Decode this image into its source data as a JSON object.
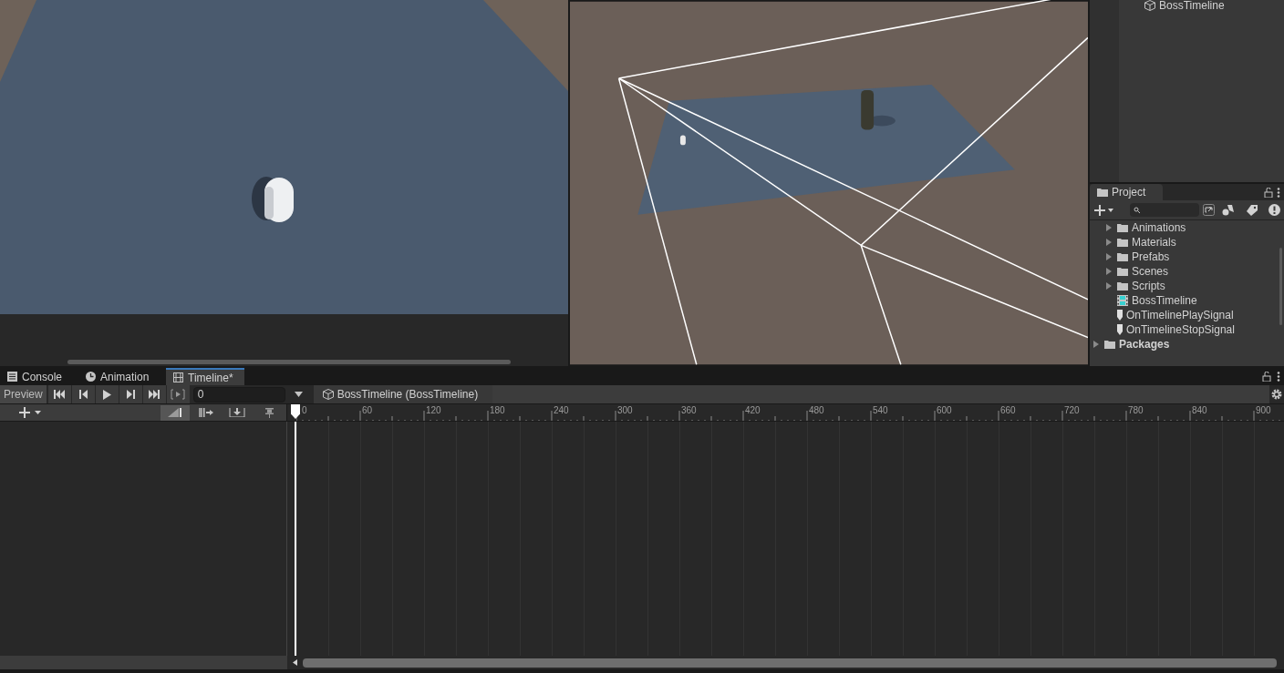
{
  "hierarchy": {
    "items": [
      {
        "label": "BossTimeline"
      }
    ]
  },
  "project": {
    "tab": "Project",
    "asset_items": [
      {
        "label": "Animations",
        "kind": "folder"
      },
      {
        "label": "Materials",
        "kind": "folder"
      },
      {
        "label": "Prefabs",
        "kind": "folder"
      },
      {
        "label": "Scenes",
        "kind": "folder"
      },
      {
        "label": "Scripts",
        "kind": "folder"
      },
      {
        "label": "BossTimeline",
        "kind": "timeline"
      },
      {
        "label": "OnTimelinePlaySignal",
        "kind": "signal"
      },
      {
        "label": "OnTimelineStopSignal",
        "kind": "signal"
      }
    ],
    "root_items": [
      {
        "label": "Packages",
        "kind": "folder"
      }
    ]
  },
  "timeline_window": {
    "tabs": [
      {
        "label": "Console",
        "kind": "console",
        "selected": false
      },
      {
        "label": "Animation",
        "kind": "animation",
        "selected": false
      },
      {
        "label": "Timeline*",
        "kind": "timeline",
        "selected": true
      }
    ],
    "preview": {
      "label": "Preview"
    },
    "frame": {
      "value": "0"
    },
    "breadcrumb": "BossTimeline (BossTimeline)",
    "ruler": [
      "0",
      "60",
      "120",
      "180",
      "240",
      "300",
      "360",
      "420",
      "480",
      "540",
      "600",
      "660",
      "720",
      "780",
      "840",
      "900"
    ]
  }
}
